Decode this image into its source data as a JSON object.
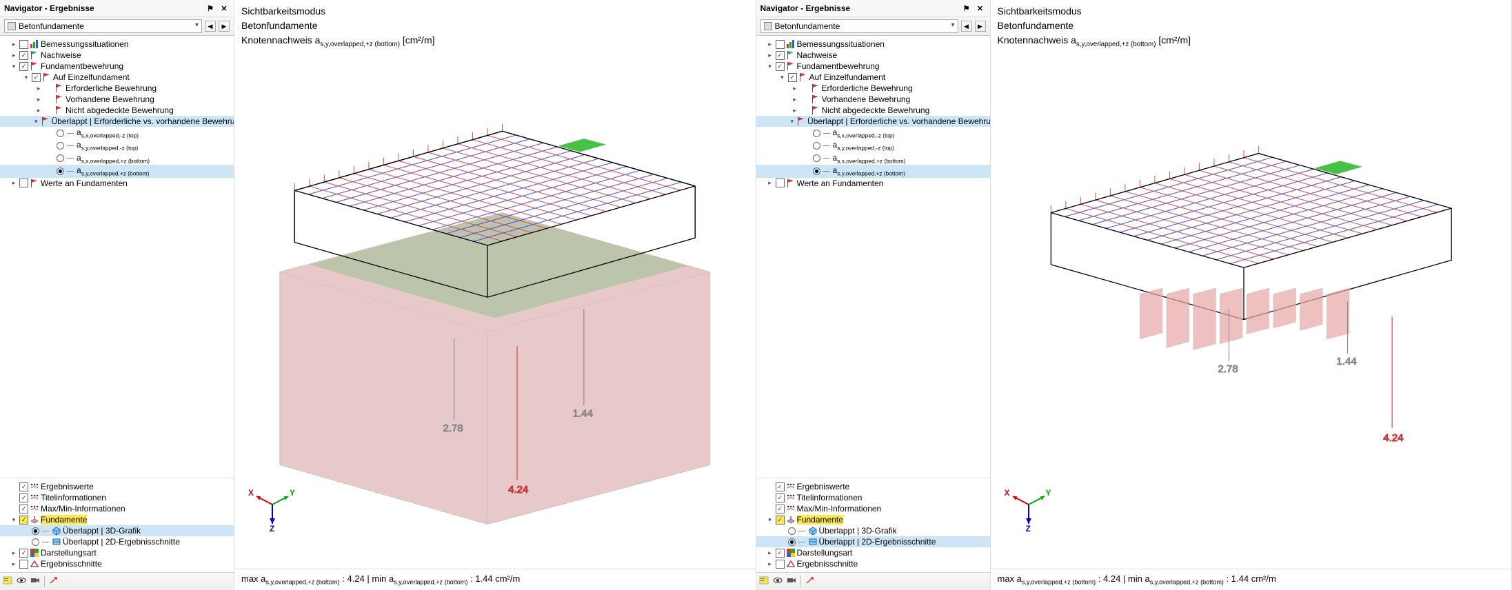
{
  "panels": [
    {
      "nav": {
        "title": "Navigator - Ergebnisse",
        "dropdown": "Betonfundamente",
        "tree_top": [
          {
            "type": "node",
            "depth": 0,
            "exp": ">",
            "check": "off",
            "icon": "bar",
            "label": "Bemessungssituationen"
          },
          {
            "type": "node",
            "depth": 0,
            "exp": ">",
            "check": "on",
            "icon": "flag-green",
            "label": "Nachweise"
          },
          {
            "type": "node",
            "depth": 0,
            "exp": "v",
            "check": "on",
            "icon": "flag-red",
            "label": "Fundamentbewehrung"
          },
          {
            "type": "node",
            "depth": 1,
            "exp": "v",
            "check": "on",
            "icon": "flag-red",
            "label": "Auf Einzelfundament"
          },
          {
            "type": "node",
            "depth": 2,
            "exp": ">",
            "check": "",
            "icon": "flag-red",
            "label": "Erforderliche Bewehrung"
          },
          {
            "type": "node",
            "depth": 2,
            "exp": ">",
            "check": "",
            "icon": "flag-red",
            "label": "Vorhandene Bewehrung"
          },
          {
            "type": "node",
            "depth": 2,
            "exp": ">",
            "check": "",
            "icon": "flag-red",
            "label": "Nicht abgedeckte Bewehrung"
          },
          {
            "type": "node",
            "depth": 2,
            "exp": "v",
            "check": "",
            "icon": "flag-red",
            "label": "Überlappt | Erforderliche vs. vorhandene Bewehrung",
            "sel": true
          },
          {
            "type": "radio",
            "depth": 3,
            "sel": false,
            "label": "a_s,x,overlapped,-z (top)"
          },
          {
            "type": "radio",
            "depth": 3,
            "sel": false,
            "label": "a_s,y,overlapped,-z (top)"
          },
          {
            "type": "radio",
            "depth": 3,
            "sel": false,
            "label": "a_s,x,overlapped,+z (bottom)"
          },
          {
            "type": "radio",
            "depth": 3,
            "sel": true,
            "label": "a_s,y,overlapped,+z (bottom)"
          },
          {
            "type": "node",
            "depth": 0,
            "exp": ">",
            "check": "off",
            "icon": "flag-red",
            "label": "Werte an Fundamenten"
          }
        ],
        "tree_bottom": [
          {
            "type": "node",
            "depth": 0,
            "exp": "",
            "check": "on",
            "icon": "dots",
            "label": "Ergebniswerte"
          },
          {
            "type": "node",
            "depth": 0,
            "exp": "",
            "check": "on",
            "icon": "dots",
            "label": "Titelinformationen"
          },
          {
            "type": "node",
            "depth": 0,
            "exp": "",
            "check": "on",
            "icon": "dots",
            "label": "Max/Min-Informationen"
          },
          {
            "type": "node",
            "depth": 0,
            "exp": "v",
            "check": "ylw",
            "icon": "fund",
            "label": "Fundamente",
            "hl": true
          },
          {
            "type": "radio",
            "depth": 1,
            "sel": true,
            "icon": "g3d",
            "label": "Überlappt | 3D-Grafik",
            "rowsel": true
          },
          {
            "type": "radio",
            "depth": 1,
            "sel": false,
            "icon": "g2d",
            "label": "Überlappt | 2D-Ergebnisschnitte"
          },
          {
            "type": "node",
            "depth": 0,
            "exp": ">",
            "check": "on",
            "icon": "color",
            "label": "Darstellungsart"
          },
          {
            "type": "node",
            "depth": 0,
            "exp": ">",
            "check": "off",
            "icon": "section",
            "label": "Ergebnisschnitte"
          }
        ]
      },
      "view": {
        "line1": "Sichtbarkeitsmodus",
        "line2": "Betonfundamente",
        "line3_pre": "Knotennachweis a",
        "line3_sub": "s,y,overlapped,+z (bottom)",
        "line3_unit": " [cm²/m]",
        "vals": {
          "a": "2.78",
          "b": "1.44",
          "c": "4.24"
        },
        "axes": {
          "x": "X",
          "y": "Y",
          "z": "Z"
        },
        "mode": "3d",
        "status_max_label": "max a",
        "status_max_sub": "s,y,overlapped,+z (bottom)",
        "status_max_val": " : 4.24 | ",
        "status_min_label": "min a",
        "status_min_sub": "s,y,overlapped,+z (bottom)",
        "status_min_val": " : 1.44 cm²/m"
      }
    },
    {
      "nav": {
        "title": "Navigator - Ergebnisse",
        "dropdown": "Betonfundamente",
        "tree_top": [
          {
            "type": "node",
            "depth": 0,
            "exp": ">",
            "check": "off",
            "icon": "bar",
            "label": "Bemessungssituationen"
          },
          {
            "type": "node",
            "depth": 0,
            "exp": ">",
            "check": "on",
            "icon": "flag-green",
            "label": "Nachweise"
          },
          {
            "type": "node",
            "depth": 0,
            "exp": "v",
            "check": "on",
            "icon": "flag-red",
            "label": "Fundamentbewehrung"
          },
          {
            "type": "node",
            "depth": 1,
            "exp": "v",
            "check": "on",
            "icon": "flag-red",
            "label": "Auf Einzelfundament"
          },
          {
            "type": "node",
            "depth": 2,
            "exp": ">",
            "check": "",
            "icon": "flag-red",
            "label": "Erforderliche Bewehrung"
          },
          {
            "type": "node",
            "depth": 2,
            "exp": ">",
            "check": "",
            "icon": "flag-red",
            "label": "Vorhandene Bewehrung"
          },
          {
            "type": "node",
            "depth": 2,
            "exp": ">",
            "check": "",
            "icon": "flag-red",
            "label": "Nicht abgedeckte Bewehrung"
          },
          {
            "type": "node",
            "depth": 2,
            "exp": "v",
            "check": "",
            "icon": "flag-red",
            "label": "Überlappt | Erforderliche vs. vorhandene Bewehrung",
            "sel": true
          },
          {
            "type": "radio",
            "depth": 3,
            "sel": false,
            "label": "a_s,x,overlapped,-z (top)"
          },
          {
            "type": "radio",
            "depth": 3,
            "sel": false,
            "label": "a_s,y,overlapped,-z (top)"
          },
          {
            "type": "radio",
            "depth": 3,
            "sel": false,
            "label": "a_s,x,overlapped,+z (bottom)"
          },
          {
            "type": "radio",
            "depth": 3,
            "sel": true,
            "label": "a_s,y,overlapped,+z (bottom)"
          },
          {
            "type": "node",
            "depth": 0,
            "exp": ">",
            "check": "off",
            "icon": "flag-red",
            "label": "Werte an Fundamenten"
          }
        ],
        "tree_bottom": [
          {
            "type": "node",
            "depth": 0,
            "exp": "",
            "check": "on",
            "icon": "dots",
            "label": "Ergebniswerte"
          },
          {
            "type": "node",
            "depth": 0,
            "exp": "",
            "check": "on",
            "icon": "dots",
            "label": "Titelinformationen"
          },
          {
            "type": "node",
            "depth": 0,
            "exp": "",
            "check": "on",
            "icon": "dots",
            "label": "Max/Min-Informationen"
          },
          {
            "type": "node",
            "depth": 0,
            "exp": "v",
            "check": "ylw",
            "icon": "fund",
            "label": "Fundamente",
            "hl": true
          },
          {
            "type": "radio",
            "depth": 1,
            "sel": false,
            "icon": "g3d",
            "label": "Überlappt | 3D-Grafik"
          },
          {
            "type": "radio",
            "depth": 1,
            "sel": true,
            "icon": "g2d",
            "label": "Überlappt | 2D-Ergebnisschnitte",
            "rowsel": true
          },
          {
            "type": "node",
            "depth": 0,
            "exp": ">",
            "check": "on",
            "icon": "color",
            "label": "Darstellungsart"
          },
          {
            "type": "node",
            "depth": 0,
            "exp": ">",
            "check": "off",
            "icon": "section",
            "label": "Ergebnisschnitte"
          }
        ]
      },
      "view": {
        "line1": "Sichtbarkeitsmodus",
        "line2": "Betonfundamente",
        "line3_pre": "Knotennachweis a",
        "line3_sub": "s,y,overlapped,+z (bottom)",
        "line3_unit": " [cm²/m]",
        "vals": {
          "a": "2.78",
          "b": "1.44",
          "c": "4.24"
        },
        "axes": {
          "x": "X",
          "y": "Y",
          "z": "Z"
        },
        "mode": "2d",
        "status_max_label": "max a",
        "status_max_sub": "s,y,overlapped,+z (bottom)",
        "status_max_val": " : 4.24 | ",
        "status_min_label": "min a",
        "status_min_sub": "s,y,overlapped,+z (bottom)",
        "status_min_val": " : 1.44 cm²/m"
      }
    }
  ]
}
